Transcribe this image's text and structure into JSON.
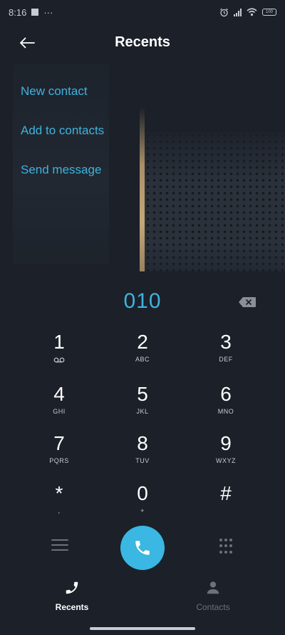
{
  "status": {
    "time": "8:16",
    "dots": "···",
    "battery": "100"
  },
  "header": {
    "title": "Recents"
  },
  "menu": [
    {
      "id": "new-contact",
      "label": "New contact"
    },
    {
      "id": "add-to-contacts",
      "label": "Add to contacts"
    },
    {
      "id": "send-message",
      "label": "Send message"
    }
  ],
  "dialer": {
    "number": "010"
  },
  "keypad": [
    {
      "digit": "1",
      "letters": ""
    },
    {
      "digit": "2",
      "letters": "ABC"
    },
    {
      "digit": "3",
      "letters": "DEF"
    },
    {
      "digit": "4",
      "letters": "GHI"
    },
    {
      "digit": "5",
      "letters": "JKL"
    },
    {
      "digit": "6",
      "letters": "MNO"
    },
    {
      "digit": "7",
      "letters": "PQRS"
    },
    {
      "digit": "8",
      "letters": "TUV"
    },
    {
      "digit": "9",
      "letters": "WXYZ"
    },
    {
      "digit": "*",
      "letters": ","
    },
    {
      "digit": "0",
      "letters": "+"
    },
    {
      "digit": "#",
      "letters": ""
    }
  ],
  "nav": {
    "recents": "Recents",
    "contacts": "Contacts"
  },
  "colors": {
    "accent": "#3fb2dd",
    "call": "#3ab7e2",
    "background": "#1b2029",
    "muted": "#6b727c"
  },
  "icons": {
    "back": "arrow-left-icon",
    "backspace": "backspace-icon",
    "call": "phone-icon",
    "voicemail": "voicemail-icon",
    "menu": "menu-icon",
    "dialpad": "dialpad-icon",
    "contacts": "person-icon"
  }
}
